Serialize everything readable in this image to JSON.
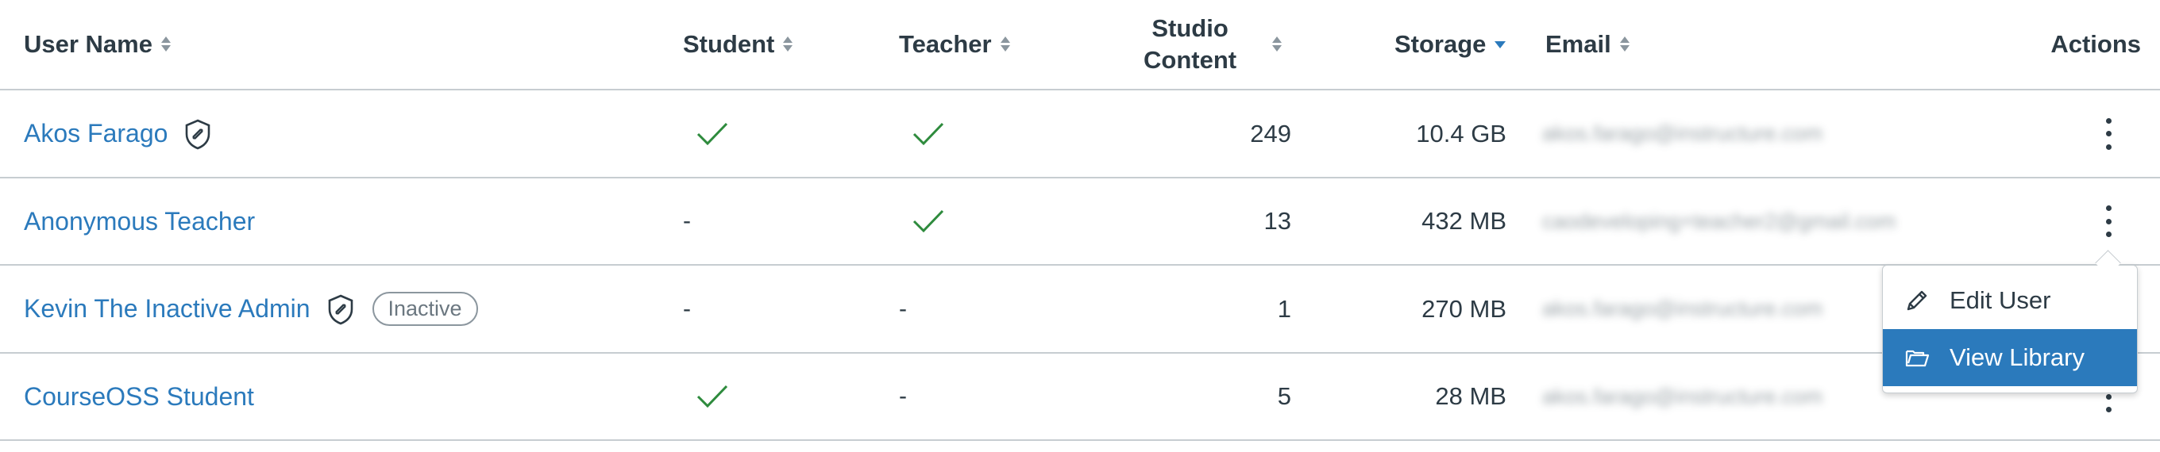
{
  "header": {
    "user_name": "User Name",
    "student": "Student",
    "teacher": "Teacher",
    "studio_content_line1": "Studio",
    "studio_content_line2": "Content",
    "storage": "Storage",
    "email": "Email",
    "actions": "Actions"
  },
  "sort": {
    "active_column": "storage",
    "direction": "descending"
  },
  "rows": [
    {
      "name": "Akos Farago",
      "admin_badge": true,
      "status": "",
      "student": "check",
      "teacher": "check",
      "studio_content": "249",
      "storage": "10.4 GB",
      "email": "akos.farago@instructure.com"
    },
    {
      "name": "Anonymous Teacher",
      "admin_badge": false,
      "status": "",
      "student": "-",
      "teacher": "check",
      "studio_content": "13",
      "storage": "432 MB",
      "email": "caodeveloping+teacher2@gmail.com"
    },
    {
      "name": "Kevin The Inactive Admin",
      "admin_badge": true,
      "status": "Inactive",
      "student": "-",
      "teacher": "-",
      "studio_content": "1",
      "storage": "270 MB",
      "email": "akos.farago@instructure.com"
    },
    {
      "name": "CourseOSS Student",
      "admin_badge": false,
      "status": "",
      "student": "check",
      "teacher": "-",
      "studio_content": "5",
      "storage": "28 MB",
      "email": "akos.farago@instructure.com"
    }
  ],
  "menu": {
    "items": [
      {
        "label": "Edit User",
        "icon": "pencil-icon",
        "selected": false
      },
      {
        "label": "View Library",
        "icon": "folder-icon",
        "selected": true
      }
    ]
  },
  "colors": {
    "link": "#2b7abc",
    "check": "#2e8b3d",
    "selected_bg": "#2b7abc",
    "border": "#c7cdd1",
    "text": "#2d3b45"
  }
}
